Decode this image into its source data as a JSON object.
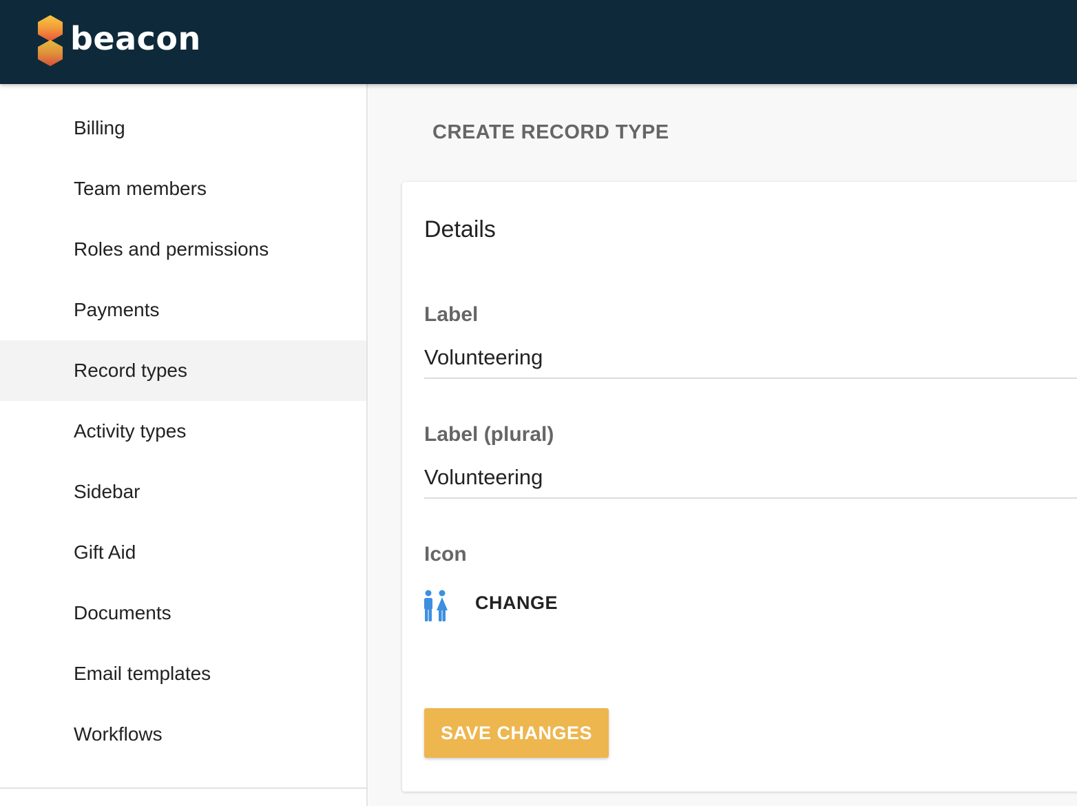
{
  "app": {
    "name": "beacon",
    "colors": {
      "topbar": "#0e2a3a",
      "accent": "#edb64f",
      "logo_gradient_top": "#f6c842",
      "logo_gradient_bottom": "#e8533a",
      "icon_blue": "#3d8fe0"
    }
  },
  "sidebar": {
    "items": [
      {
        "label": "Billing",
        "active": false
      },
      {
        "label": "Team members",
        "active": false
      },
      {
        "label": "Roles and permissions",
        "active": false
      },
      {
        "label": "Payments",
        "active": false
      },
      {
        "label": "Record types",
        "active": true
      },
      {
        "label": "Activity types",
        "active": false
      },
      {
        "label": "Sidebar",
        "active": false
      },
      {
        "label": "Gift Aid",
        "active": false
      },
      {
        "label": "Documents",
        "active": false
      },
      {
        "label": "Email templates",
        "active": false
      },
      {
        "label": "Workflows",
        "active": false
      }
    ]
  },
  "main": {
    "page_title": "CREATE RECORD TYPE",
    "card": {
      "title": "Details",
      "label_field": {
        "label": "Label",
        "value": "Volunteering"
      },
      "label_plural_field": {
        "label": "Label (plural)",
        "value": "Volunteering"
      },
      "icon_field": {
        "label": "Icon",
        "icon": "people-icon",
        "change_label": "CHANGE"
      },
      "save_label": "SAVE CHANGES"
    }
  }
}
